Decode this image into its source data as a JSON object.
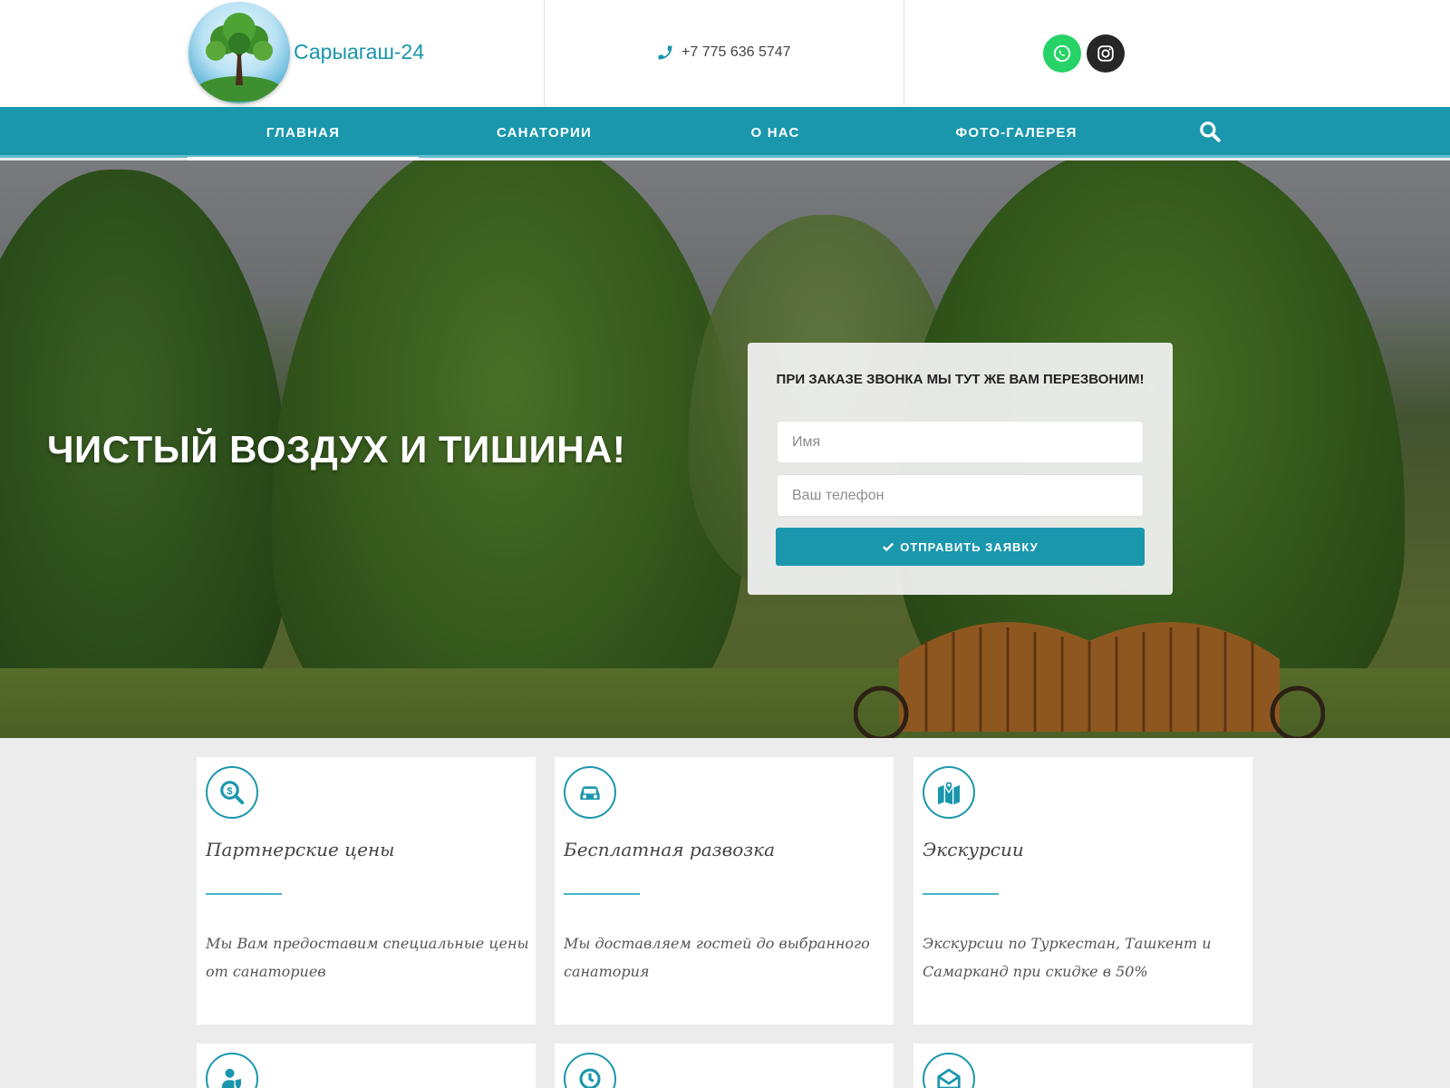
{
  "header": {
    "brand": "Сарыагаш-24",
    "phone": "+7 775 636 5747",
    "social": [
      "whatsapp-icon",
      "instagram-icon"
    ]
  },
  "nav": {
    "items": [
      {
        "label": "ГЛАВНАЯ",
        "active": true
      },
      {
        "label": "САНАТОРИИ",
        "active": false
      },
      {
        "label": "О НАС",
        "active": false
      },
      {
        "label": "ФОТО-ГАЛЕРЕЯ",
        "active": false
      }
    ],
    "search_icon": "search-icon"
  },
  "hero": {
    "title": "ЧИСТЫЙ ВОЗДУХ И ТИШИНА!"
  },
  "callback_form": {
    "title": "ПРИ ЗАКАЗЕ ЗВОНКА МЫ ТУТ ЖЕ ВАМ ПЕРЕЗВОНИМ!",
    "name_placeholder": "Имя",
    "name_value": "",
    "phone_placeholder": "Ваш телефон",
    "phone_value": "",
    "submit_label": "ОТПРАВИТЬ ЗАЯВКУ"
  },
  "features": [
    {
      "icon": "dollar-search-icon",
      "title": "Партнерские цены",
      "text": "Мы Вам предоставим специальные цены от санаториев"
    },
    {
      "icon": "car-icon",
      "title": "Бесплатная развозка",
      "text": "Мы доставляем гостей до выбранного санатория"
    },
    {
      "icon": "map-pin-icon",
      "title": "Экскурсии",
      "text": "Экскурсии по Туркестан, Ташкент и Самарканд при скидке в 50%"
    }
  ],
  "features_row2_icons": [
    "user-shield-icon",
    "clock-icon",
    "envelope-open-icon"
  ],
  "colors": {
    "accent": "#1a97ad",
    "nav_underline": "#62bccc",
    "whatsapp": "#25d366",
    "instagram": "#262626",
    "page_bg": "#ececec"
  }
}
